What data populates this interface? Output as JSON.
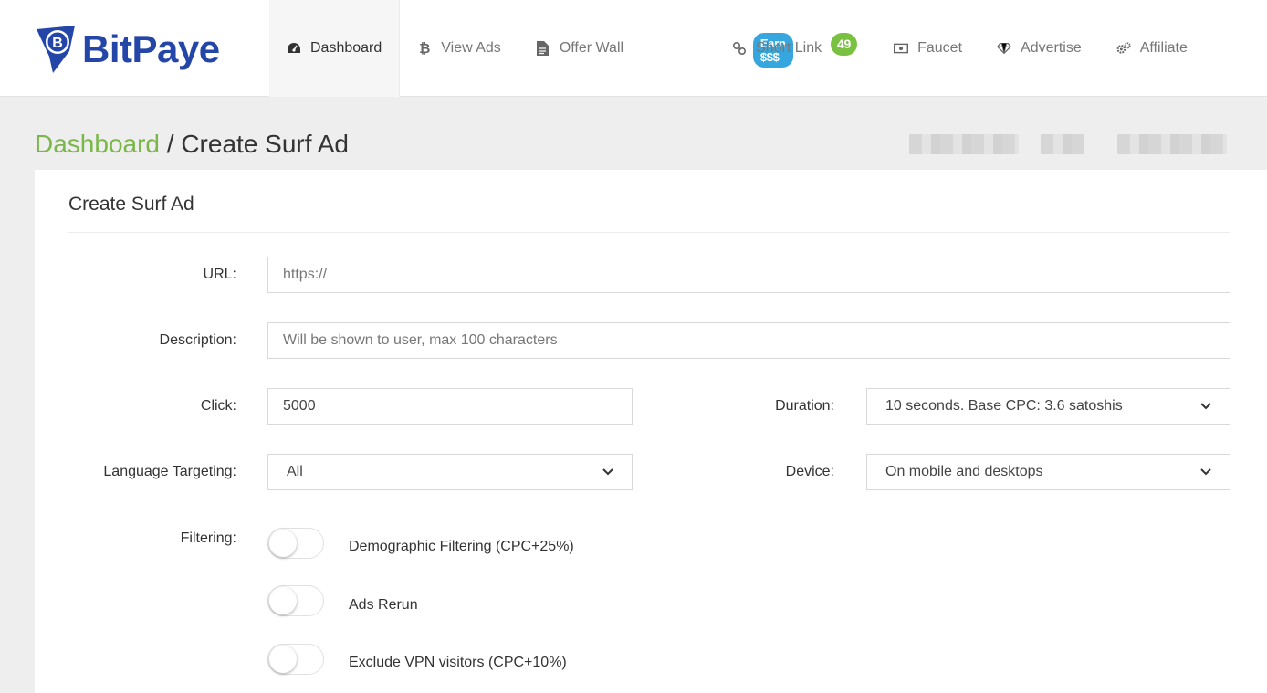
{
  "brand": {
    "name": "BitPaye",
    "color": "#2446a8"
  },
  "nav": [
    {
      "id": "dashboard",
      "label": "Dashboard",
      "icon": "speedometer-icon",
      "active": true
    },
    {
      "id": "view-ads",
      "label": "View Ads",
      "icon": "bitcoin-icon"
    },
    {
      "id": "offer-wall",
      "label": "Offer Wall",
      "icon": "document-icon",
      "badge": "Earn $$$"
    },
    {
      "id": "short-link",
      "label": "Short Link",
      "icon": "link-icon",
      "badge": "49"
    },
    {
      "id": "faucet",
      "label": "Faucet",
      "icon": "money-icon"
    },
    {
      "id": "advertise",
      "label": "Advertise",
      "icon": "diamond-icon"
    },
    {
      "id": "affiliate",
      "label": "Affiliate",
      "icon": "gears-icon"
    }
  ],
  "breadcrumb": {
    "home": "Dashboard",
    "separator": " / ",
    "current": "Create Surf Ad"
  },
  "form": {
    "title": "Create Surf Ad",
    "url_label": "URL:",
    "url_placeholder": "https://",
    "description_label": "Description:",
    "description_placeholder": "Will be shown to user, max 100 characters",
    "click_label": "Click:",
    "click_value": "5000",
    "duration_label": "Duration:",
    "duration_value": "10 seconds. Base CPC: 3.6 satoshis",
    "language_label": "Language Targeting:",
    "language_value": "All",
    "device_label": "Device:",
    "device_value": "On mobile and desktops",
    "filtering_label": "Filtering:",
    "toggles": [
      {
        "label": "Demographic Filtering (CPC+25%)",
        "on": false
      },
      {
        "label": "Ads Rerun",
        "on": false
      },
      {
        "label": "Exclude VPN visitors (CPC+10%)",
        "on": false
      }
    ]
  },
  "colors": {
    "accent_green": "#7ab648",
    "badge_blue": "#35a7de",
    "badge_green": "#7ac142"
  }
}
